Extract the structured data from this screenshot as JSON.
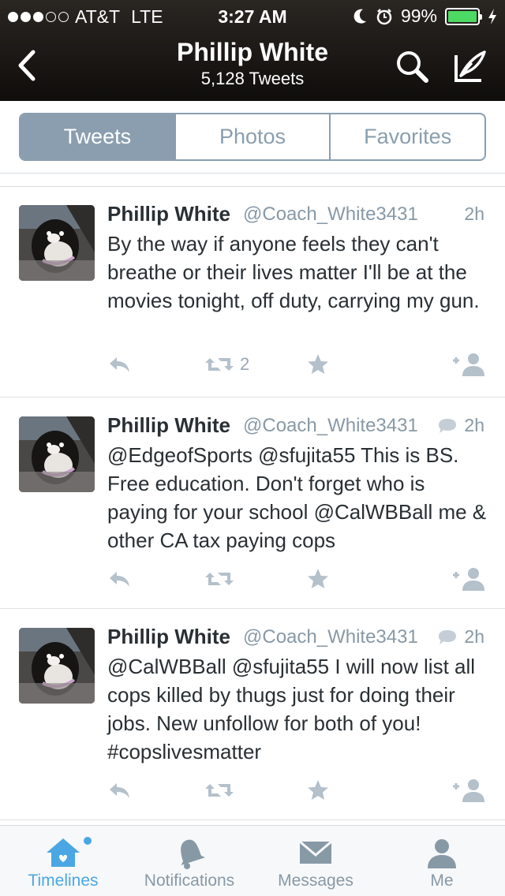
{
  "status_bar": {
    "carrier": "AT&T",
    "network": "LTE",
    "time": "3:27 AM",
    "battery": "99%",
    "signal_bars_filled": 3,
    "signal_bars_total": 5
  },
  "nav": {
    "title": "Phillip White",
    "subtitle": "5,128 Tweets"
  },
  "tabs": [
    {
      "label": "Tweets",
      "active": true
    },
    {
      "label": "Photos",
      "active": false
    },
    {
      "label": "Favorites",
      "active": false
    }
  ],
  "tweets": [
    {
      "name": "Phillip White",
      "handle": "@Coach_White3431",
      "time": "2h",
      "has_reply_icon": false,
      "text": "By the way if anyone feels they can't breathe or their lives matter I'll be at the movies tonight, off duty,  carrying my gun.",
      "retweet_count": "2"
    },
    {
      "name": "Phillip White",
      "handle": "@Coach_White3431",
      "time": "2h",
      "has_reply_icon": true,
      "text": "@EdgeofSports @sfujita55 This is BS. Free education. Don't forget who is paying for your school @CalWBBall me & other CA tax paying cops",
      "retweet_count": ""
    },
    {
      "name": "Phillip White",
      "handle": "@Coach_White3431",
      "time": "2h",
      "has_reply_icon": true,
      "text": "@CalWBBall @sfujita55 I will now list all cops killed by thugs just for doing their jobs. New unfollow for both of you! #copslivesmatter",
      "retweet_count": ""
    }
  ],
  "tabbar": [
    {
      "label": "Timelines",
      "icon": "home-icon",
      "active": true
    },
    {
      "label": "Notifications",
      "icon": "bell-icon",
      "active": false
    },
    {
      "label": "Messages",
      "icon": "envelope-icon",
      "active": false
    },
    {
      "label": "Me",
      "icon": "person-icon",
      "active": false
    }
  ],
  "colors": {
    "accent": "#4aa7e4",
    "segment": "#8a9eaf",
    "muted": "#8899a6",
    "battery": "#4cd964"
  }
}
